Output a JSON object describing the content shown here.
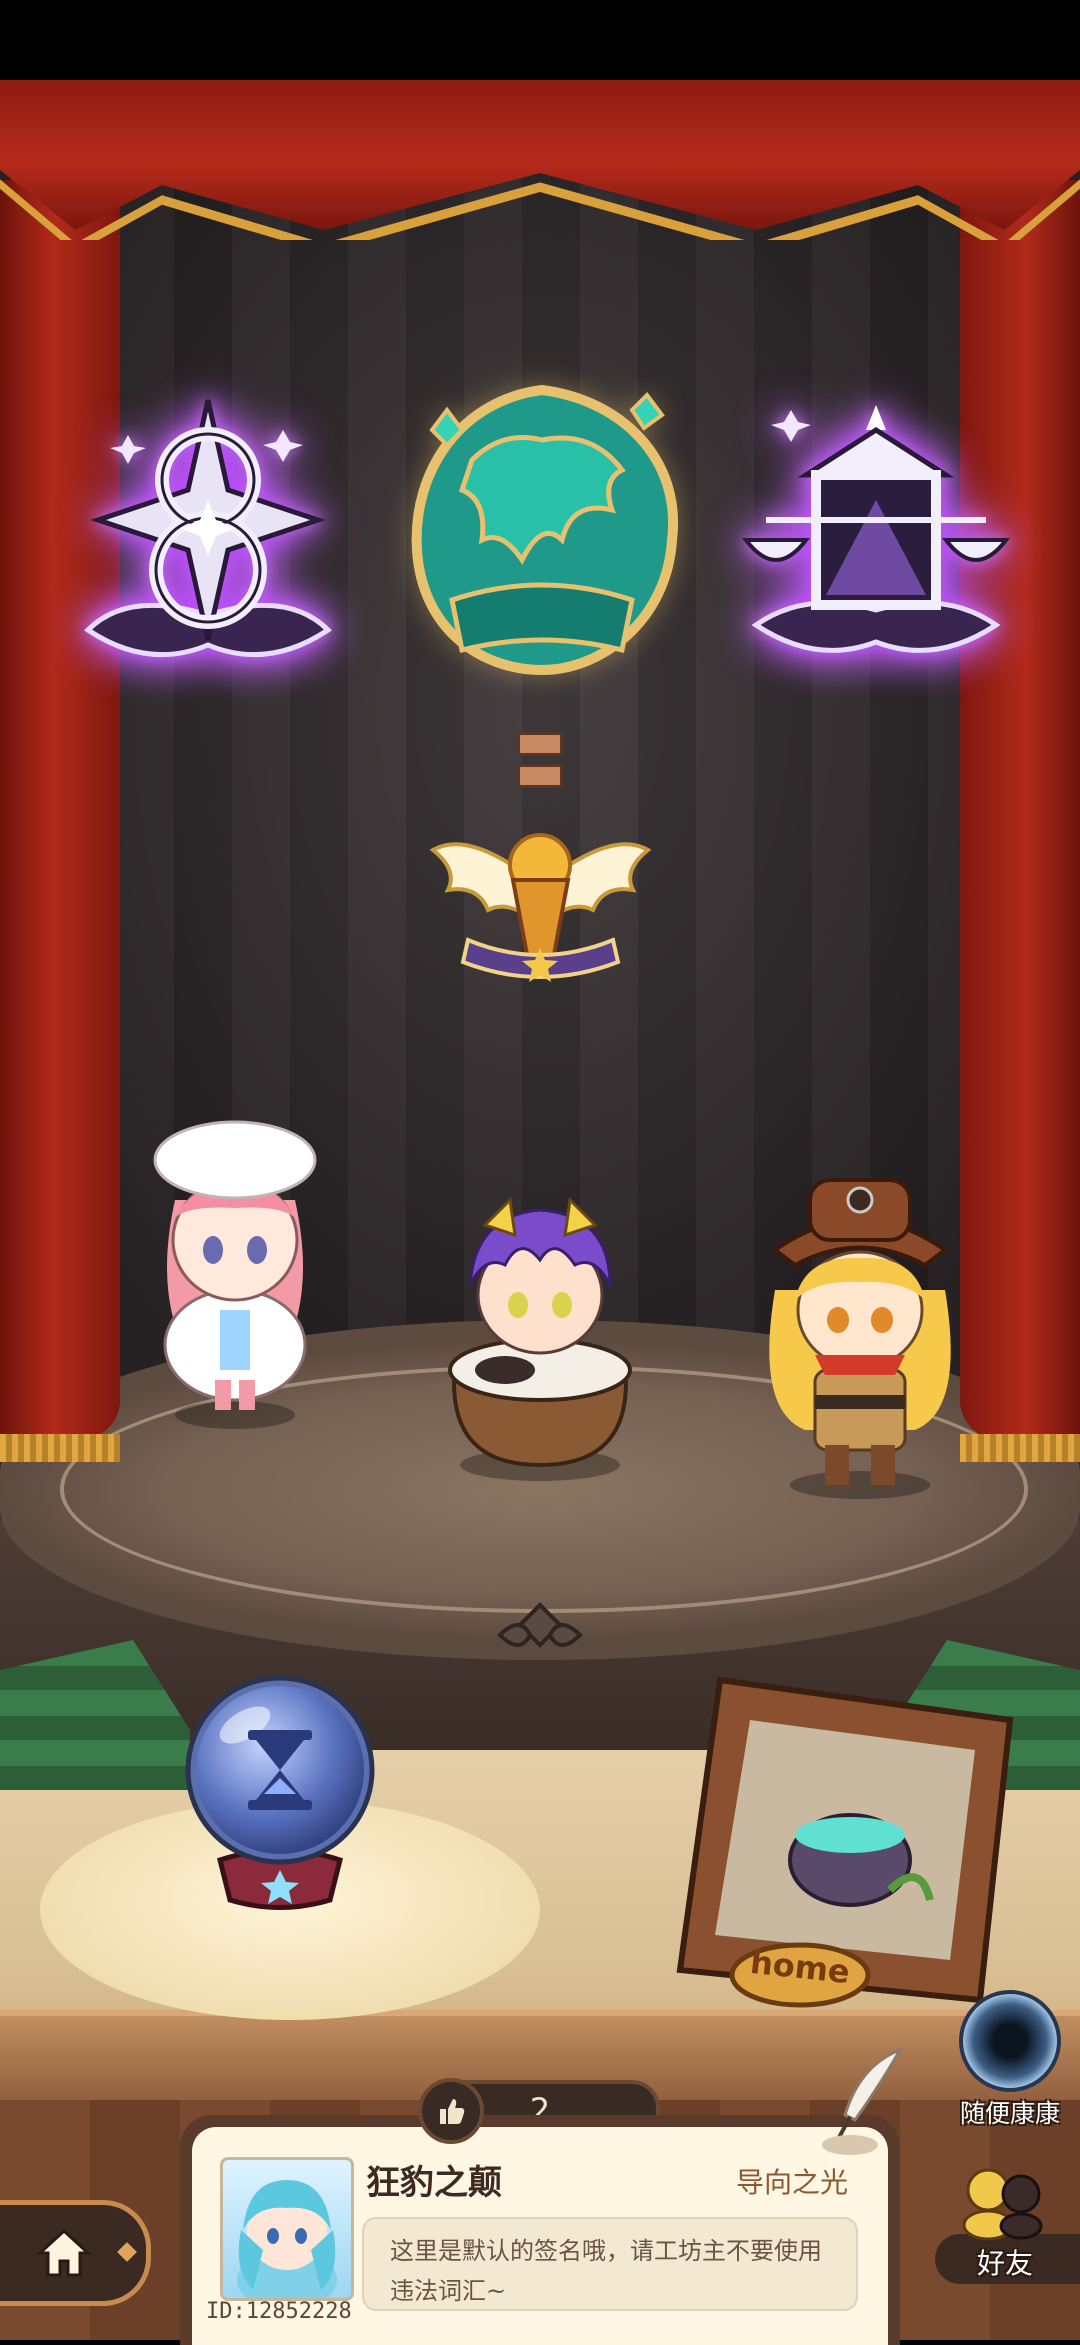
{
  "stage": {
    "badges": [
      "figure-eight-star-badge",
      "teal-lion-badge",
      "lantern-scales-badge"
    ],
    "center_badge": "winged-torch-badge",
    "characters": [
      "pink-hair-girl-with-white-hat",
      "purple-hair-boy-in-pot",
      "blonde-explorer-girl-with-hat"
    ]
  },
  "items": {
    "crystal_ball_icon": "hourglass-icon",
    "home_frame_label": "home"
  },
  "likes": {
    "count": "2",
    "icon": "thumbs-up-icon"
  },
  "profile": {
    "username": "狂豹之颠",
    "title": "导向之光",
    "signature": "这里是默认的签名哦，请工坊主不要使用违法词汇~",
    "user_id": "ID:12852228"
  },
  "side_entries": {
    "random_visit_label": "随便康康",
    "friends_label": "好友"
  },
  "colors": {
    "curtain_red": "#b22a1a",
    "gold_trim": "#d9a13c",
    "purple_glow": "#b63cff",
    "teal_badge": "#1f9a8a",
    "card_bg": "#fff6e4"
  }
}
